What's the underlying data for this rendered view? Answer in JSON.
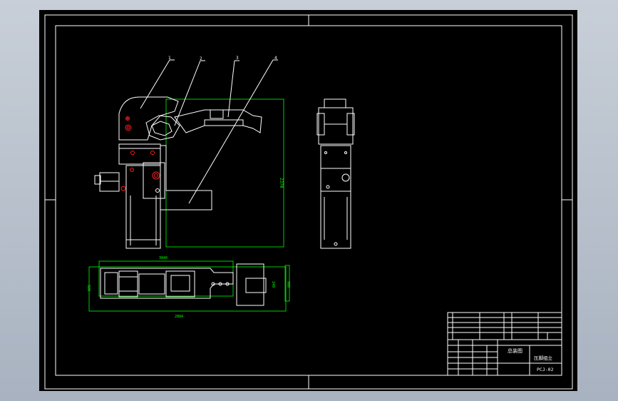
{
  "balloons": [
    "1",
    "2",
    "3",
    "4"
  ],
  "dimensions": {
    "front_height": "2370",
    "top_width": "3840",
    "top_overall": "2884",
    "top_left": "920",
    "top_right_outer": "960",
    "top_right_inner": "240"
  },
  "title_block": {
    "assembly": "总装图",
    "name": "压脚组立",
    "drawing_no": "PCJ-02"
  },
  "colors": {
    "sheet": "#000000",
    "outline": "#ffffff",
    "dimension": "#00ff00",
    "hole": "#ff2020"
  }
}
